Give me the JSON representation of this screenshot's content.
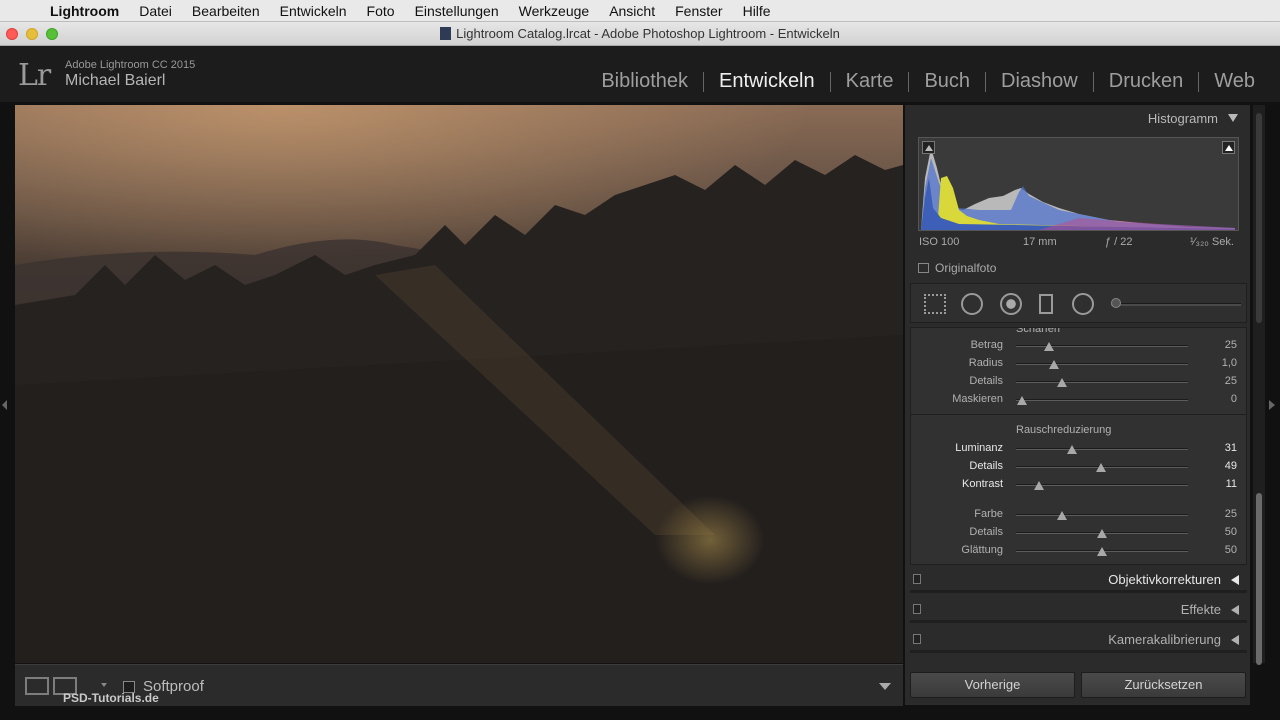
{
  "menubar": {
    "app": "Lightroom",
    "items": [
      "Datei",
      "Bearbeiten",
      "Entwickeln",
      "Foto",
      "Einstellungen",
      "Werkzeuge",
      "Ansicht",
      "Fenster",
      "Hilfe"
    ]
  },
  "window": {
    "title": "Lightroom Catalog.lrcat - Adobe Photoshop Lightroom - Entwickeln"
  },
  "identity": {
    "logo": "Lr",
    "product": "Adobe Lightroom CC 2015",
    "user": "Michael Baierl"
  },
  "modules": [
    {
      "label": "Bibliothek",
      "active": false
    },
    {
      "label": "Entwickeln",
      "active": true
    },
    {
      "label": "Karte",
      "active": false
    },
    {
      "label": "Buch",
      "active": false
    },
    {
      "label": "Diashow",
      "active": false
    },
    {
      "label": "Drucken",
      "active": false
    },
    {
      "label": "Web",
      "active": false
    }
  ],
  "toolbar": {
    "softproof_label": "Softproof",
    "watermark": "PSD-Tutorials.de"
  },
  "histogram": {
    "title": "Histogramm",
    "iso": "ISO 100",
    "focal": "17 mm",
    "aperture": "ƒ / 22",
    "shutter": "¹⁄₃₂₀ Sek.",
    "original_label": "Originalfoto"
  },
  "detail": {
    "sharpen_title": "Schärfen",
    "sharpen": [
      {
        "label": "Betrag",
        "value": "25",
        "pos": 0.19
      },
      {
        "label": "Radius",
        "value": "1,0",
        "pos": 0.22
      },
      {
        "label": "Details",
        "value": "25",
        "pos": 0.27
      },
      {
        "label": "Maskieren",
        "value": "0",
        "pos": 0.0
      }
    ],
    "noise_title": "Rauschreduzierung",
    "noise_luminance": [
      {
        "label": "Luminanz",
        "value": "31",
        "pos": 0.33
      },
      {
        "label": "Details",
        "value": "49",
        "pos": 0.5
      },
      {
        "label": "Kontrast",
        "value": "11",
        "pos": 0.11
      }
    ],
    "noise_color": [
      {
        "label": "Farbe",
        "value": "25",
        "pos": 0.25
      },
      {
        "label": "Details",
        "value": "50",
        "pos": 0.5
      },
      {
        "label": "Glättung",
        "value": "50",
        "pos": 0.5
      }
    ]
  },
  "panels": [
    {
      "label": "Objektivkorrekturen"
    },
    {
      "label": "Effekte"
    },
    {
      "label": "Kamerakalibrierung"
    }
  ],
  "buttons": {
    "previous": "Vorherige",
    "reset": "Zurücksetzen"
  }
}
